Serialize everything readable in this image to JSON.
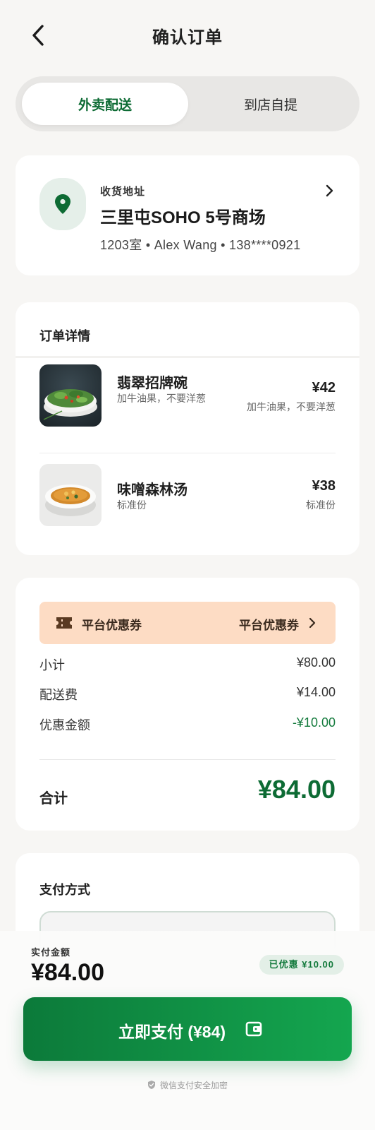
{
  "header": {
    "title": "确认订单",
    "back_icon": "chevron-left-icon"
  },
  "delivery_toggle": {
    "active": "外卖配送",
    "inactive": "到店自提"
  },
  "address": {
    "label": "收货地址",
    "place": "三里屯SOHO 5号商场",
    "detail": "1203室 • Alex Wang • 138****0921",
    "icon": "location-pin-icon"
  },
  "order": {
    "title": "订单详情",
    "items": [
      {
        "name": "翡翠招牌碗",
        "note": "加牛油果，不要洋葱",
        "price": "¥42",
        "price_note": "加牛油果，不要洋葱"
      },
      {
        "name": "味噌森林汤",
        "note": "标准份",
        "price": "¥38",
        "price_note": "标准份"
      }
    ]
  },
  "summary": {
    "coupon_label": "平台优惠券",
    "coupon_value": "平台优惠券",
    "rows": [
      {
        "label": "小计",
        "value": "¥80.00"
      },
      {
        "label": "配送费",
        "value": "¥14.00"
      },
      {
        "label": "优惠金额",
        "value": "-¥10.00"
      }
    ],
    "total_label": "合计",
    "total_value": "¥84.00"
  },
  "payment": {
    "title": "支付方式"
  },
  "footer": {
    "paid_label": "实付金额",
    "paid_amount": "¥84.00",
    "discount_badge": "已优惠 ¥10.00",
    "pay_button": "立即支付 (¥84)",
    "secure_note": "微信支付安全加密"
  },
  "colors": {
    "brand_green": "#0d6b34",
    "coupon_bg": "#fddcc4",
    "page_bg": "#f7f6f4"
  }
}
